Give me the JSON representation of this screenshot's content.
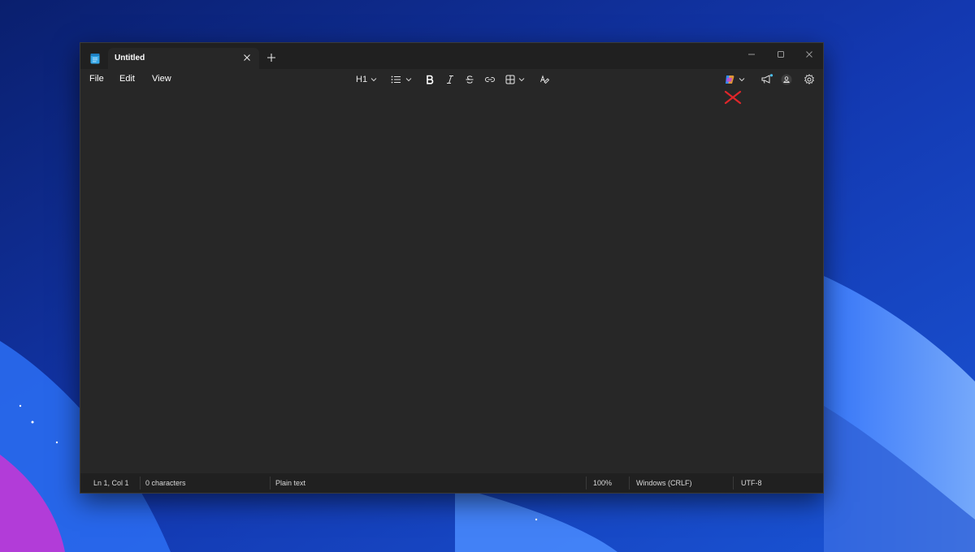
{
  "window": {
    "tab_title": "Untitled"
  },
  "menu": {
    "file": "File",
    "edit": "Edit",
    "view": "View"
  },
  "toolbar": {
    "heading_label": "H1"
  },
  "status": {
    "position": "Ln 1, Col 1",
    "characters": "0 characters",
    "format": "Plain text",
    "zoom": "100%",
    "line_ending": "Windows (CRLF)",
    "encoding": "UTF-8"
  },
  "colors": {
    "window_bg": "#202020",
    "editor_bg": "#272727",
    "annotation_red": "#e0262a",
    "notification_dot": "#4cc2ff"
  },
  "icons": [
    "notepad-icon",
    "tab-close-icon",
    "add-tab-icon",
    "minimize-icon",
    "maximize-icon",
    "close-icon",
    "list-icon",
    "bold-icon",
    "italic-icon",
    "strikethrough-icon",
    "link-icon",
    "table-icon",
    "clear-formatting-icon",
    "copilot-icon",
    "announcement-icon",
    "account-icon",
    "gear-icon"
  ]
}
